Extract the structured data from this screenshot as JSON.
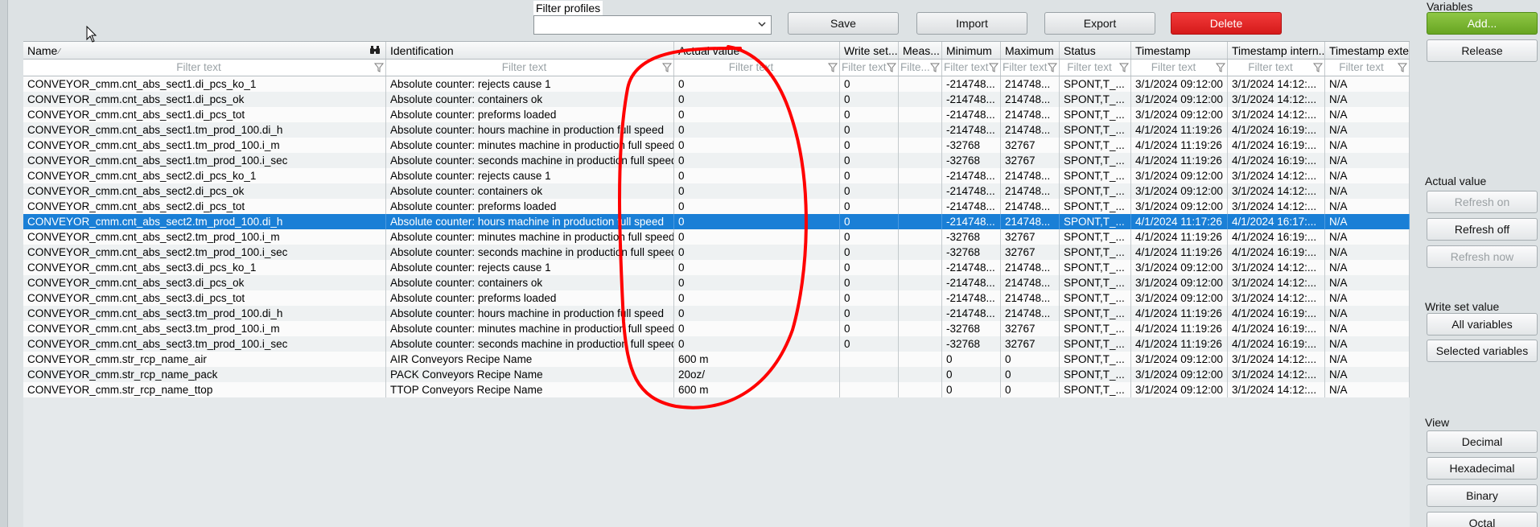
{
  "toolbar": {
    "filter_profiles_label": "Filter profiles",
    "filter_profiles_value": "",
    "save_label": "Save",
    "import_label": "Import",
    "export_label": "Export",
    "delete_label": "Delete"
  },
  "grid": {
    "columns": [
      "Name",
      "Identification",
      "Actual value",
      "Write set...",
      "Meas...",
      "Minimum",
      "Maximum",
      "Status",
      "Timestamp",
      "Timestamp intern...",
      "Timestamp exter..."
    ],
    "filter_placeholder": "Filter text",
    "filter_placeholder_short": "Filte...",
    "rows": [
      [
        "CONVEYOR_cmm.cnt_abs_sect1.di_pcs_ko_1",
        "Absolute counter: rejects cause 1",
        "0",
        "0",
        "",
        "-214748...",
        "214748...",
        "SPONT,T_...",
        "3/1/2024 09:12:00",
        "3/1/2024 14:12:...",
        "N/A"
      ],
      [
        "CONVEYOR_cmm.cnt_abs_sect1.di_pcs_ok",
        "Absolute counter: containers ok",
        "0",
        "0",
        "",
        "-214748...",
        "214748...",
        "SPONT,T_...",
        "3/1/2024 09:12:00",
        "3/1/2024 14:12:...",
        "N/A"
      ],
      [
        "CONVEYOR_cmm.cnt_abs_sect1.di_pcs_tot",
        "Absolute counter: preforms loaded",
        "0",
        "0",
        "",
        "-214748...",
        "214748...",
        "SPONT,T_...",
        "3/1/2024 09:12:00",
        "3/1/2024 14:12:...",
        "N/A"
      ],
      [
        "CONVEYOR_cmm.cnt_abs_sect1.tm_prod_100.di_h",
        "Absolute counter: hours machine in production full speed",
        "0",
        "0",
        "",
        "-214748...",
        "214748...",
        "SPONT,T_...",
        "4/1/2024 11:19:26",
        "4/1/2024 16:19:...",
        "N/A"
      ],
      [
        "CONVEYOR_cmm.cnt_abs_sect1.tm_prod_100.i_m",
        "Absolute counter: minutes machine in production full speed",
        "0",
        "0",
        "",
        "-32768",
        "32767",
        "SPONT,T_...",
        "4/1/2024 11:19:26",
        "4/1/2024 16:19:...",
        "N/A"
      ],
      [
        "CONVEYOR_cmm.cnt_abs_sect1.tm_prod_100.i_sec",
        "Absolute counter: seconds machine in production full speed",
        "0",
        "0",
        "",
        "-32768",
        "32767",
        "SPONT,T_...",
        "4/1/2024 11:19:26",
        "4/1/2024 16:19:...",
        "N/A"
      ],
      [
        "CONVEYOR_cmm.cnt_abs_sect2.di_pcs_ko_1",
        "Absolute counter: rejects cause 1",
        "0",
        "0",
        "",
        "-214748...",
        "214748...",
        "SPONT,T_...",
        "3/1/2024 09:12:00",
        "3/1/2024 14:12:...",
        "N/A"
      ],
      [
        "CONVEYOR_cmm.cnt_abs_sect2.di_pcs_ok",
        "Absolute counter: containers ok",
        "0",
        "0",
        "",
        "-214748...",
        "214748...",
        "SPONT,T_...",
        "3/1/2024 09:12:00",
        "3/1/2024 14:12:...",
        "N/A"
      ],
      [
        "CONVEYOR_cmm.cnt_abs_sect2.di_pcs_tot",
        "Absolute counter: preforms loaded",
        "0",
        "0",
        "",
        "-214748...",
        "214748...",
        "SPONT,T_...",
        "3/1/2024 09:12:00",
        "3/1/2024 14:12:...",
        "N/A"
      ],
      [
        "CONVEYOR_cmm.cnt_abs_sect2.tm_prod_100.di_h",
        "Absolute counter: hours machine in production full speed",
        "0",
        "0",
        "",
        "-214748...",
        "214748...",
        "SPONT,T_...",
        "4/1/2024 11:17:26",
        "4/1/2024 16:17:...",
        "N/A"
      ],
      [
        "CONVEYOR_cmm.cnt_abs_sect2.tm_prod_100.i_m",
        "Absolute counter: minutes machine in production full speed",
        "0",
        "0",
        "",
        "-32768",
        "32767",
        "SPONT,T_...",
        "4/1/2024 11:19:26",
        "4/1/2024 16:19:...",
        "N/A"
      ],
      [
        "CONVEYOR_cmm.cnt_abs_sect2.tm_prod_100.i_sec",
        "Absolute counter: seconds machine in production full speed",
        "0",
        "0",
        "",
        "-32768",
        "32767",
        "SPONT,T_...",
        "4/1/2024 11:19:26",
        "4/1/2024 16:19:...",
        "N/A"
      ],
      [
        "CONVEYOR_cmm.cnt_abs_sect3.di_pcs_ko_1",
        "Absolute counter: rejects cause 1",
        "0",
        "0",
        "",
        "-214748...",
        "214748...",
        "SPONT,T_...",
        "3/1/2024 09:12:00",
        "3/1/2024 14:12:...",
        "N/A"
      ],
      [
        "CONVEYOR_cmm.cnt_abs_sect3.di_pcs_ok",
        "Absolute counter: containers ok",
        "0",
        "0",
        "",
        "-214748...",
        "214748...",
        "SPONT,T_...",
        "3/1/2024 09:12:00",
        "3/1/2024 14:12:...",
        "N/A"
      ],
      [
        "CONVEYOR_cmm.cnt_abs_sect3.di_pcs_tot",
        "Absolute counter: preforms loaded",
        "0",
        "0",
        "",
        "-214748...",
        "214748...",
        "SPONT,T_...",
        "3/1/2024 09:12:00",
        "3/1/2024 14:12:...",
        "N/A"
      ],
      [
        "CONVEYOR_cmm.cnt_abs_sect3.tm_prod_100.di_h",
        "Absolute counter: hours machine in production full speed",
        "0",
        "0",
        "",
        "-214748...",
        "214748...",
        "SPONT,T_...",
        "4/1/2024 11:19:26",
        "4/1/2024 16:19:...",
        "N/A"
      ],
      [
        "CONVEYOR_cmm.cnt_abs_sect3.tm_prod_100.i_m",
        "Absolute counter: minutes machine in production full speed",
        "0",
        "0",
        "",
        "-32768",
        "32767",
        "SPONT,T_...",
        "4/1/2024 11:19:26",
        "4/1/2024 16:19:...",
        "N/A"
      ],
      [
        "CONVEYOR_cmm.cnt_abs_sect3.tm_prod_100.i_sec",
        "Absolute counter: seconds machine in production full speed",
        "0",
        "0",
        "",
        "-32768",
        "32767",
        "SPONT,T_...",
        "4/1/2024 11:19:26",
        "4/1/2024 16:19:...",
        "N/A"
      ],
      [
        "CONVEYOR_cmm.str_rcp_name_air",
        "AIR Conveyors Recipe Name",
        "600 m",
        "",
        "",
        "0",
        "0",
        "SPONT,T_...",
        "3/1/2024 09:12:00",
        "3/1/2024 14:12:...",
        "N/A"
      ],
      [
        "CONVEYOR_cmm.str_rcp_name_pack",
        "PACK Conveyors Recipe Name",
        "20oz/",
        "",
        "",
        "0",
        "0",
        "SPONT,T_...",
        "3/1/2024 09:12:00",
        "3/1/2024 14:12:...",
        "N/A"
      ],
      [
        "CONVEYOR_cmm.str_rcp_name_ttop",
        "TTOP Conveyors Recipe Name",
        "600 m",
        "",
        "",
        "0",
        "0",
        "SPONT,T_...",
        "3/1/2024 09:12:00",
        "3/1/2024 14:12:...",
        "N/A"
      ]
    ],
    "selected_row": 9
  },
  "right_panel": {
    "variables_title": "Variables",
    "add_label": "Add...",
    "release_label": "Release",
    "actual_value_title": "Actual value",
    "refresh_on_label": "Refresh on",
    "refresh_off_label": "Refresh off",
    "refresh_now_label": "Refresh now",
    "write_set_value_title": "Write set value",
    "all_variables_label": "All variables",
    "selected_variables_label": "Selected variables",
    "view_title": "View",
    "decimal_label": "Decimal",
    "hexadecimal_label": "Hexadecimal",
    "binary_label": "Binary",
    "octal_label": "Octal"
  },
  "colors": {
    "selection": "#1a7fd6",
    "delete_button": "#e02828",
    "add_button": "#79b733",
    "annotation": "#ff0000"
  }
}
